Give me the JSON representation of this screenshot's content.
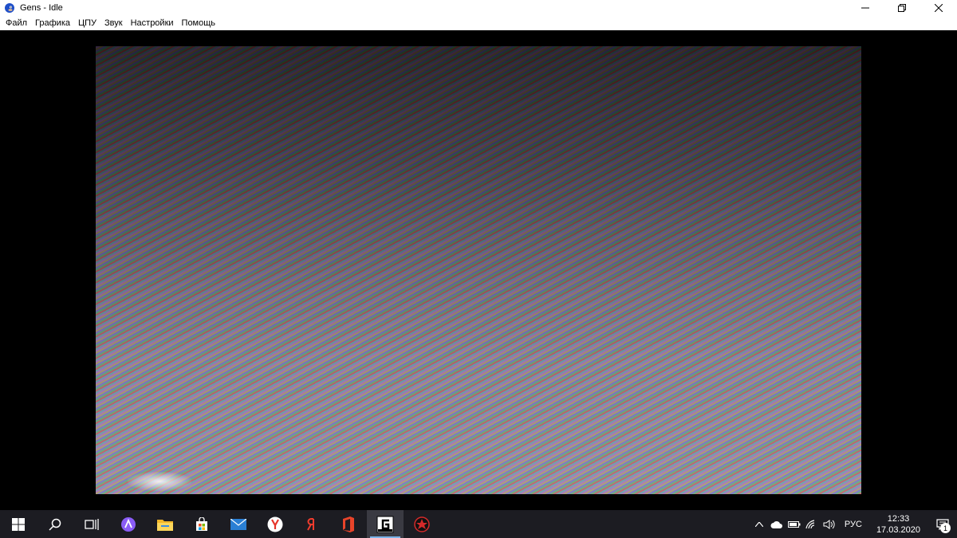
{
  "window": {
    "title": "Gens - Idle",
    "icons": {
      "app": "sonic-icon",
      "minimize": "minimize-icon",
      "restore": "restore-icon",
      "close": "close-icon"
    }
  },
  "menubar": {
    "items": [
      "Файл",
      "Графика",
      "ЦПУ",
      "Звук",
      "Настройки",
      "Помощь"
    ]
  },
  "emulator": {
    "screen": "noisy-diagonal-static"
  },
  "taskbar": {
    "start_icon": "windows-start-icon",
    "pinned": [
      {
        "name": "search-icon"
      },
      {
        "name": "task-view-icon"
      },
      {
        "name": "alice-assistant-icon"
      },
      {
        "name": "file-explorer-icon"
      },
      {
        "name": "microsoft-store-icon"
      },
      {
        "name": "mail-icon"
      },
      {
        "name": "yandex-browser-icon"
      },
      {
        "name": "yandex-icon"
      },
      {
        "name": "office-icon"
      },
      {
        "name": "gens-icon",
        "active": true
      },
      {
        "name": "red-app-icon"
      }
    ],
    "tray": {
      "language": "РУС",
      "time": "12:33",
      "date": "17.03.2020",
      "notifications_count": "1"
    }
  }
}
